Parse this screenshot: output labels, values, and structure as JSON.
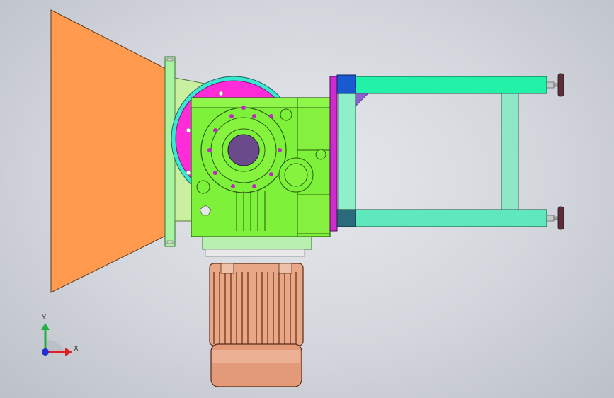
{
  "viewport": {
    "background": "#d3d6dc"
  },
  "triad": {
    "y_label": "Y",
    "x_label": "X",
    "x_color": "#e02020",
    "y_color": "#20b040",
    "z_color": "#2030d0"
  },
  "model": {
    "hopper_color": "#ff9a4e",
    "gearbox_color": "#7ef23a",
    "flange_color": "#a8f5a0",
    "frame_color": "#22f2a8",
    "motor_color": "#e8a888",
    "accent_color": "#e020e0",
    "bolt_color": "#c028c0"
  }
}
